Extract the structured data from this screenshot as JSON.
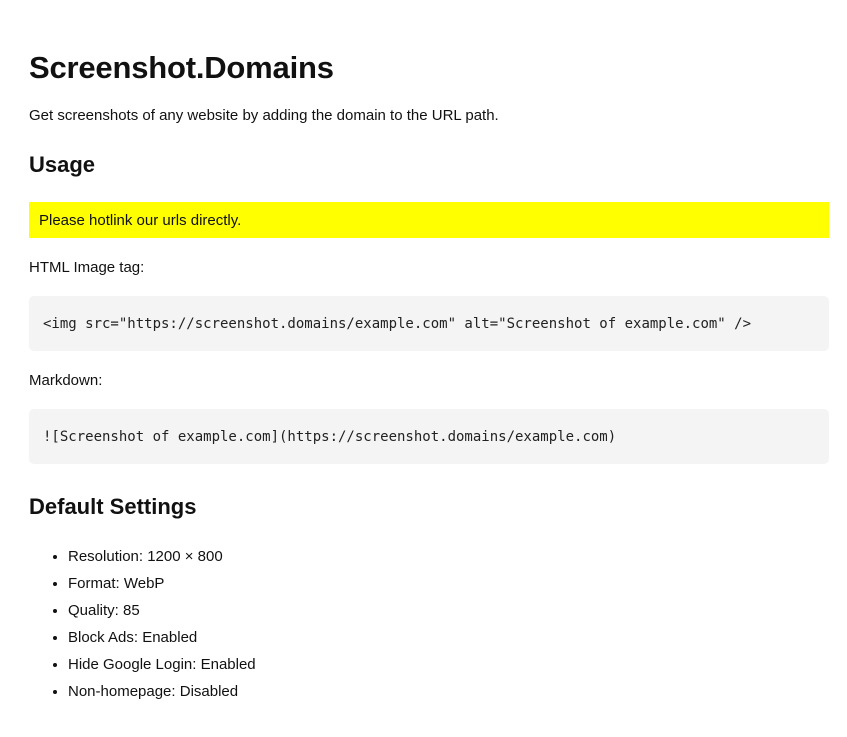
{
  "page": {
    "title": "Screenshot.Domains",
    "intro": "Get screenshots of any website by adding the domain to the URL path."
  },
  "usage": {
    "heading": "Usage",
    "notice": "Please hotlink our urls directly.",
    "notice_color": "#ffff00",
    "html_label": "HTML Image tag:",
    "html_code": "<img src=\"https://screenshot.domains/example.com\" alt=\"Screenshot of example.com\" />",
    "markdown_label": "Markdown:",
    "markdown_code": "![Screenshot of example.com](https://screenshot.domains/example.com)"
  },
  "defaults": {
    "heading": "Default Settings",
    "items": [
      "Resolution: 1200 × 800",
      "Format: WebP",
      "Quality: 85",
      "Block Ads: Enabled",
      "Hide Google Login: Enabled",
      "Non-homepage: Disabled"
    ]
  }
}
